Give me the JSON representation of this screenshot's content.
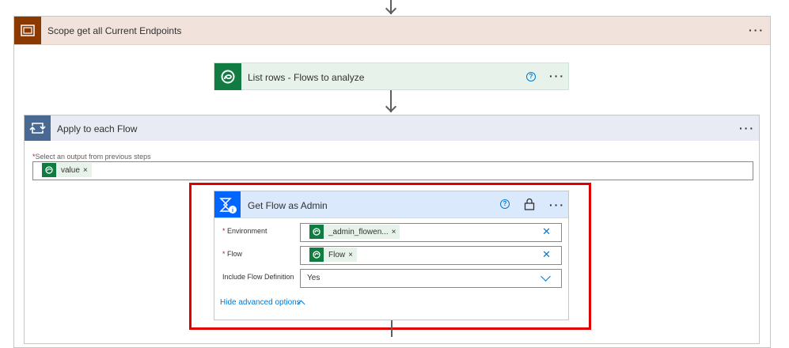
{
  "scope": {
    "title": "Scope get all Current Endpoints",
    "icon": "scope-icon",
    "more_label": "···"
  },
  "list_rows": {
    "title": "List rows - Flows to analyze",
    "icon": "dataverse-icon",
    "help": "?",
    "more_label": "···"
  },
  "apply_each": {
    "title": "Apply to each Flow",
    "icon": "loop-icon",
    "more_label": "···",
    "select_required": "*",
    "select_label": "Select an output from previous steps",
    "token": {
      "label": "value",
      "remove": "×"
    }
  },
  "get_flow": {
    "title": "Get Flow as Admin",
    "icon": "power-automate-management-icon",
    "help": "?",
    "more_label": "···",
    "fields": [
      {
        "required": "*",
        "label": "Environment",
        "token": "_admin_flowen...",
        "remove": "×",
        "clear": "✕"
      },
      {
        "required": "*",
        "label": "Flow",
        "token": "Flow",
        "remove": "×",
        "clear": "✕"
      },
      {
        "required": "",
        "label": "Include Flow Definition",
        "value": "Yes"
      }
    ],
    "advanced_label": "Hide advanced options"
  },
  "colors": {
    "scope_accent": "#8c3900",
    "dataverse_green": "#107c41",
    "loop_blue": "#486991",
    "pa_blue": "#0066ff",
    "highlight_red": "#e00000",
    "link_blue": "#0078d4"
  }
}
